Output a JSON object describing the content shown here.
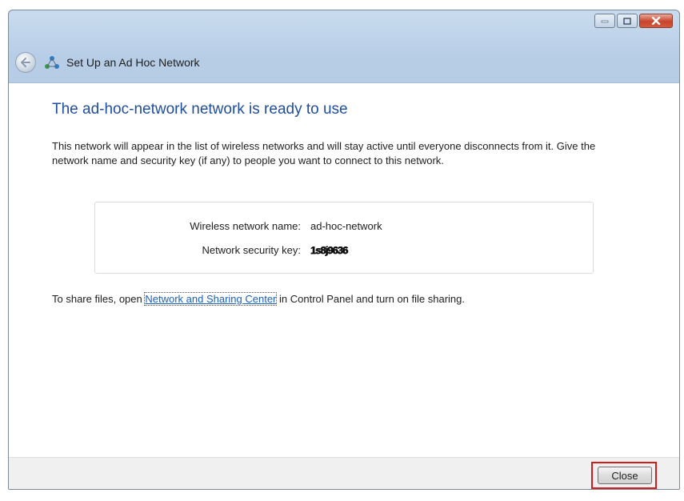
{
  "window": {
    "title": "Set Up an Ad Hoc Network",
    "caption_buttons": [
      "minimize-icon",
      "maximize-icon",
      "close-icon"
    ]
  },
  "page": {
    "heading": "The ad-hoc-network network is ready to use",
    "description": "This network will appear in the list of wireless networks and will stay active until everyone disconnects from it. Give the network name and security key (if any) to people you want to connect to this network.",
    "network_name_label": "Wireless network name:",
    "network_name_value": "ad-hoc-network",
    "security_key_label": "Network security key:",
    "security_key_value": "1s8j9636",
    "share_prefix": "To share files, open",
    "share_link": "Network and Sharing Center",
    "share_suffix": "in Control Panel and turn on file sharing."
  },
  "footer": {
    "close_label": "Close"
  },
  "colors": {
    "heading": "#1f4e9e",
    "link": "#1b5fc1",
    "highlight": "#d31c1c"
  }
}
